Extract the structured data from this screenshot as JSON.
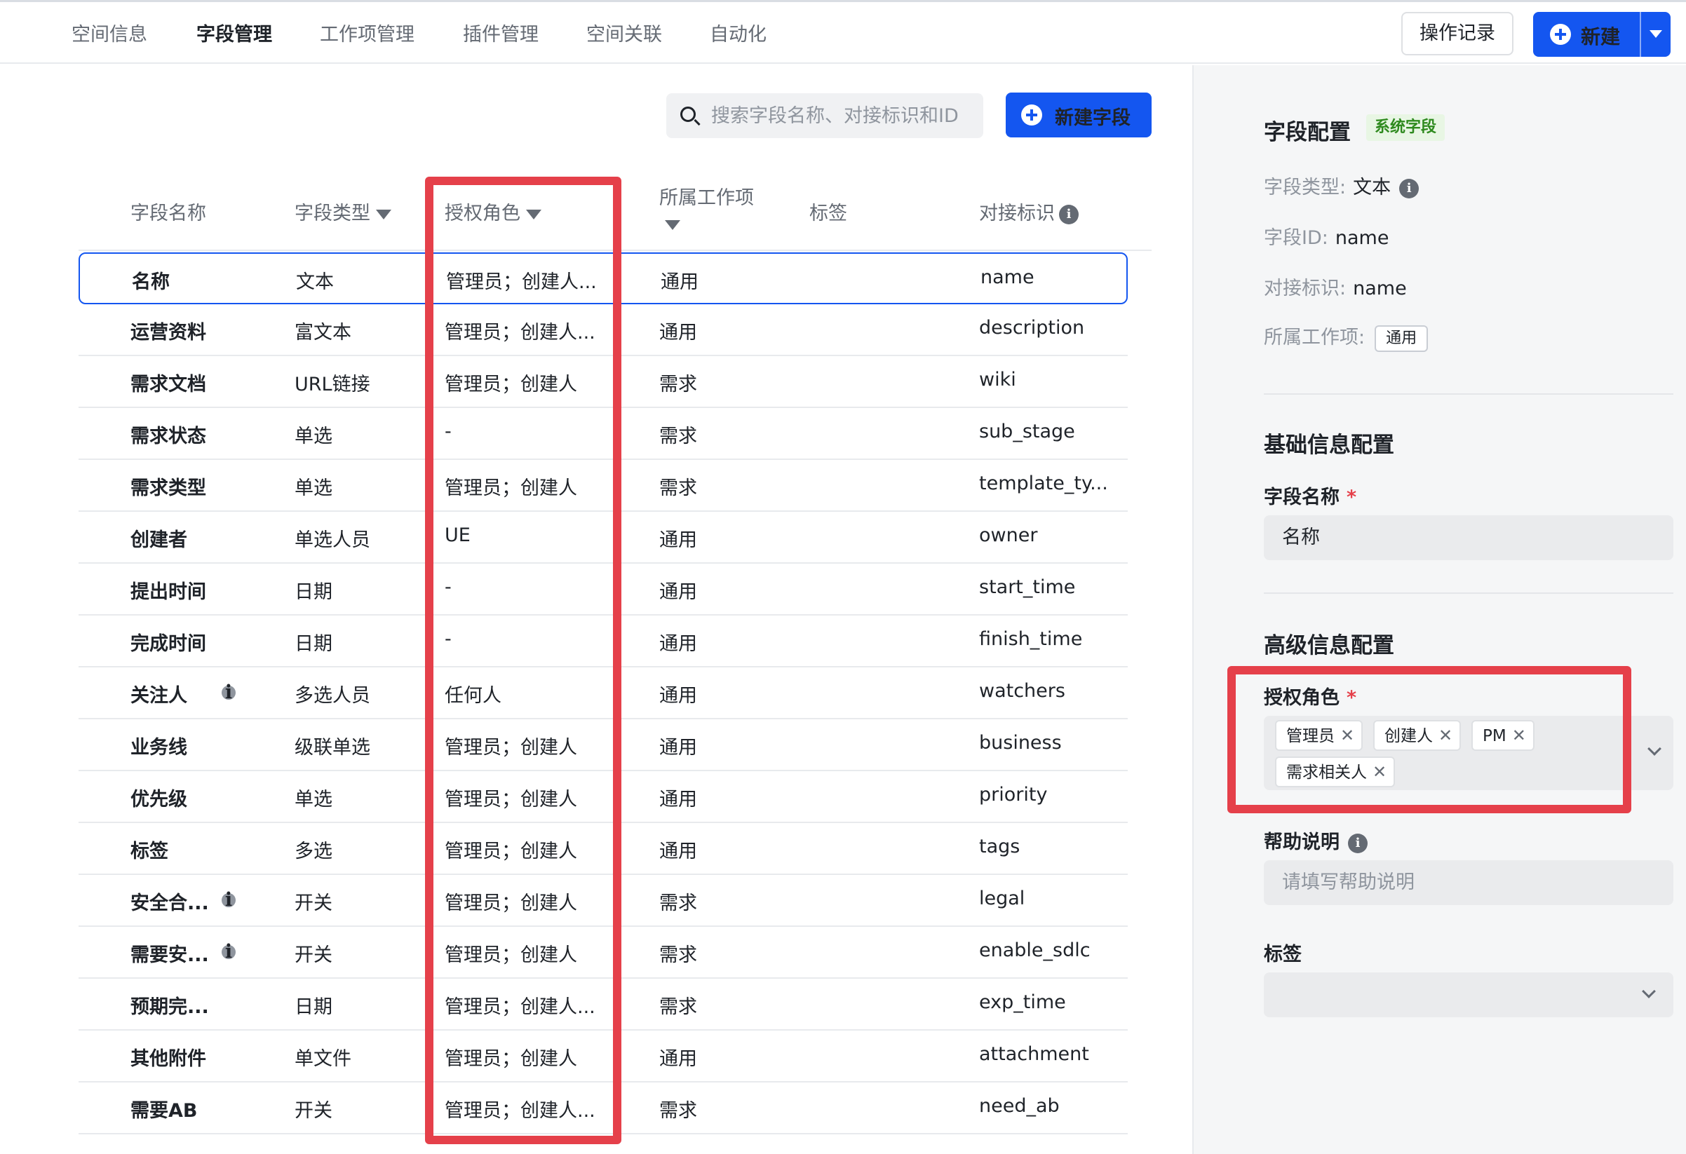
{
  "nav": {
    "tabs": [
      "空间信息",
      "字段管理",
      "工作项管理",
      "插件管理",
      "空间关联",
      "自动化"
    ],
    "active_tab": "字段管理",
    "log_button": "操作记录",
    "new_button": "新建"
  },
  "search": {
    "placeholder": "搜索字段名称、对接标识和ID"
  },
  "new_field_button": "新建字段",
  "table": {
    "headers": {
      "name": "字段名称",
      "type": "字段类型",
      "role": "授权角色",
      "item": "所属工作项",
      "tags": "标签",
      "key": "对接标识"
    },
    "rows": [
      {
        "name": "名称",
        "type": "文本",
        "role": "管理员；创建人...",
        "item": "通用",
        "key": "name",
        "info": false
      },
      {
        "name": "运营资料",
        "type": "富文本",
        "role": "管理员；创建人...",
        "item": "通用",
        "key": "description",
        "info": false
      },
      {
        "name": "需求文档",
        "type": "URL链接",
        "role": "管理员；创建人",
        "item": "需求",
        "key": "wiki",
        "info": false
      },
      {
        "name": "需求状态",
        "type": "单选",
        "role": "-",
        "item": "需求",
        "key": "sub_stage",
        "info": false
      },
      {
        "name": "需求类型",
        "type": "单选",
        "role": "管理员；创建人",
        "item": "需求",
        "key": "template_ty...",
        "info": false
      },
      {
        "name": "创建者",
        "type": "单选人员",
        "role": "UE",
        "item": "通用",
        "key": "owner",
        "info": false
      },
      {
        "name": "提出时间",
        "type": "日期",
        "role": "-",
        "item": "通用",
        "key": "start_time",
        "info": false
      },
      {
        "name": "完成时间",
        "type": "日期",
        "role": "-",
        "item": "通用",
        "key": "finish_time",
        "info": false
      },
      {
        "name": "关注人",
        "type": "多选人员",
        "role": "任何人",
        "item": "通用",
        "key": "watchers",
        "info": true
      },
      {
        "name": "业务线",
        "type": "级联单选",
        "role": "管理员；创建人",
        "item": "通用",
        "key": "business",
        "info": false
      },
      {
        "name": "优先级",
        "type": "单选",
        "role": "管理员；创建人",
        "item": "通用",
        "key": "priority",
        "info": false
      },
      {
        "name": "标签",
        "type": "多选",
        "role": "管理员；创建人",
        "item": "通用",
        "key": "tags",
        "info": false
      },
      {
        "name": "安全合...",
        "type": "开关",
        "role": "管理员；创建人",
        "item": "需求",
        "key": "legal",
        "info": true
      },
      {
        "name": "需要安...",
        "type": "开关",
        "role": "管理员；创建人",
        "item": "需求",
        "key": "enable_sdlc",
        "info": true
      },
      {
        "name": "预期完...",
        "type": "日期",
        "role": "管理员；创建人...",
        "item": "需求",
        "key": "exp_time",
        "info": false
      },
      {
        "name": "其他附件",
        "type": "单文件",
        "role": "管理员；创建人",
        "item": "通用",
        "key": "attachment",
        "info": false
      },
      {
        "name": "需要AB",
        "type": "开关",
        "role": "管理员；创建人...",
        "item": "需求",
        "key": "need_ab",
        "info": false
      }
    ]
  },
  "panel": {
    "title": "字段配置",
    "system_tag": "系统字段",
    "type_label": "字段类型:",
    "type_value": "文本",
    "id_label": "字段ID:",
    "id_value": "name",
    "key_label": "对接标识:",
    "key_value": "name",
    "item_label": "所属工作项:",
    "item_value": "通用",
    "basic_title": "基础信息配置",
    "name_label": "字段名称",
    "name_value": "名称",
    "advanced_title": "高级信息配置",
    "role_label": "授权角色",
    "roles": [
      "管理员",
      "创建人",
      "PM",
      "需求相关人"
    ],
    "help_label": "帮助说明",
    "help_placeholder": "请填写帮助说明",
    "tags_label": "标签",
    "required_mark": "*"
  },
  "colors": {
    "accent": "#1456f0",
    "highlight": "#e5404a",
    "system_tag": "#2e8a1e"
  }
}
